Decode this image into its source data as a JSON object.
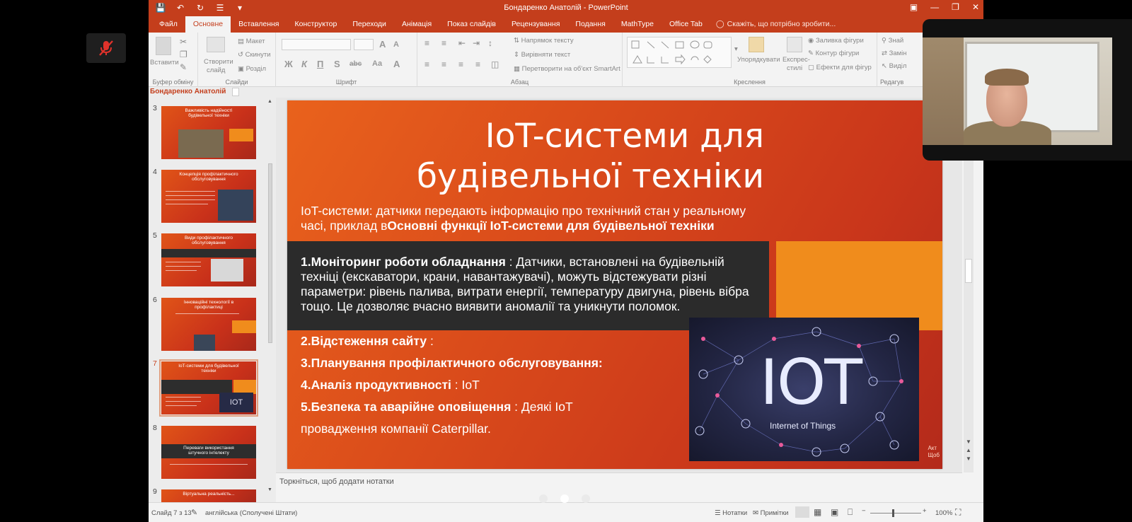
{
  "app": {
    "window_title": "Бондаренко Анатолій - PowerPoint",
    "qat_icons": [
      "save-icon",
      "undo-icon",
      "redo-icon",
      "touch-mode-icon",
      "customize-icon"
    ],
    "window_buttons": [
      "ribbon-options-icon",
      "minimize-icon",
      "restore-icon",
      "close-icon"
    ]
  },
  "tabs": [
    {
      "label": "Файл"
    },
    {
      "label": "Основне",
      "active": true
    },
    {
      "label": "Вставлення"
    },
    {
      "label": "Конструктор"
    },
    {
      "label": "Переходи"
    },
    {
      "label": "Анімація"
    },
    {
      "label": "Показ слайдів"
    },
    {
      "label": "Рецензування"
    },
    {
      "label": "Подання"
    },
    {
      "label": "MathType"
    },
    {
      "label": "Office Tab"
    }
  ],
  "tell_me": "Скажіть, що потрібно зробити...",
  "ribbon": {
    "clipboard": {
      "paste": "Вставити",
      "label": "Буфер обміну"
    },
    "slides": {
      "new_slide_1": "Створити",
      "new_slide_2": "слайд",
      "layout": "Макет",
      "reset": "Скинути",
      "section": "Розділ",
      "label": "Слайди"
    },
    "font": {
      "label": "Шрифт",
      "bold": "Ж",
      "italic": "К",
      "underline": "П",
      "shadow": "S",
      "strike": "abc",
      "case": "Aa",
      "color": "A",
      "grow": "A",
      "shrink": "A"
    },
    "paragraph": {
      "text_direction": "Напрямок тексту",
      "align_text": "Вирівняти текст",
      "smartart": "Перетворити на об'єкт SmartArt",
      "label": "Абзац"
    },
    "drawing": {
      "arrange": "Упорядкувати",
      "quick_styles_1": "Експрес-",
      "quick_styles_2": "стилі",
      "shape_fill": "Заливка фігури",
      "shape_outline": "Контур фігури",
      "shape_effects": "Ефекти для фігур",
      "label": "Креслення"
    },
    "editing": {
      "find": "Знай",
      "replace": "Замін",
      "select": "Виділ",
      "label": "Редагув"
    }
  },
  "name_box": "Бондаренко Анатолій",
  "thumbnails": [
    {
      "num": "3",
      "title": "Важливість надійності будівельної техніки"
    },
    {
      "num": "4",
      "title": "Концепція профілактичного обслуговування"
    },
    {
      "num": "5",
      "title": "Види профілактичного обслуговування"
    },
    {
      "num": "6",
      "title": "Інноваційні технології в профілактиці"
    },
    {
      "num": "7",
      "title": "IoT-системи для будівельної техніки",
      "selected": true
    },
    {
      "num": "8",
      "title": "Переваги використання штучного інтелекту"
    },
    {
      "num": "9",
      "title": "Віртуальна реальність..."
    }
  ],
  "slide": {
    "title_line1": "IoT-системи для",
    "title_line2": "будівельної техніки",
    "intro_plain": "IoT-системи: датчики передають інформацію про технічний стан у реальному часі, приклад в",
    "intro_bold": "Основні функції IoT-системи для будівельної техніки",
    "b1_head": "1.Моніторинг роботи обладнання",
    "b1_text": " : Датчики, встановлені на будівельній техніці (екскаватори, крани, навантажувачі), можуть відстежувати різні параметри: рівень палива, витрати енергії, температуру двигуна, рівень вібра тощо. Це дозволяє вчасно виявити аномалії та уникнути поломок.",
    "b2_head": "2.Відстеження сайту",
    "b2_text": " :",
    "b3_head": "3.Планування профілактичного обслуговування:",
    "b4_head": "4.Аналіз продуктивності",
    "b4_text": " : IoT",
    "b5_head": "5.Безпека та аварійне оповіщення",
    "b5_text": " : Деякі IoT",
    "b6_text": "провадження компанії Caterpillar.",
    "image_big": "IOT",
    "image_sub": "Internet of Things",
    "watermark_1": "Акт",
    "watermark_2": "Щоб"
  },
  "notes_placeholder": "Торкніться, щоб додати нотатки",
  "status": {
    "slide_of": "Слайд 7 з 13",
    "language": "англійська (Сполучені Штати)",
    "notes": "Нотатки",
    "comments": "Примітки",
    "zoom": "100%"
  },
  "colors": {
    "accent": "#c43e1c",
    "slide_orange": "#f08c1c",
    "slide_dark": "#2b2b2b"
  }
}
